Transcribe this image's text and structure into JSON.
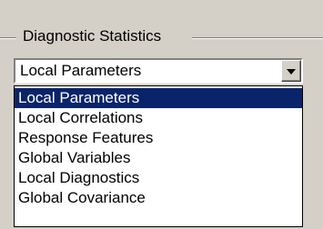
{
  "group": {
    "title": "Diagnostic Statistics"
  },
  "combo": {
    "selected_value": "Local Parameters"
  },
  "options": [
    "Local Parameters",
    "Local Correlations",
    "Response Features",
    "Global Variables",
    "Local Diagnostics",
    "Global Covariance"
  ],
  "highlighted_option": "Local Parameters",
  "colors": {
    "face": "#d4d0c8",
    "highlight": "#0a246a",
    "highlight_text": "#ffffff",
    "window": "#ffffff"
  }
}
